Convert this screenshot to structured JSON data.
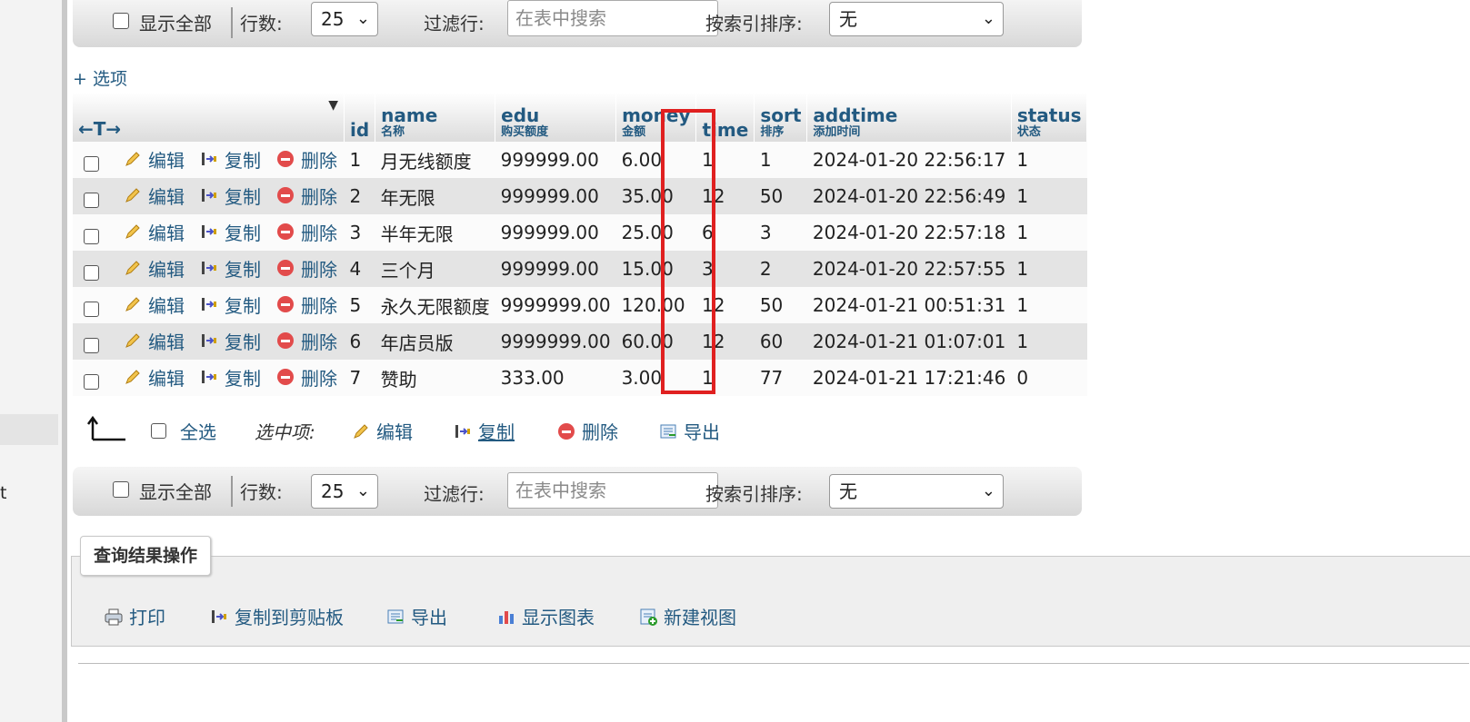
{
  "sidebar": {
    "fragment_text": "t"
  },
  "nav_top": {
    "show_all_label": "显示全部",
    "rows_label": "行数:",
    "rows_value": "25",
    "filter_label": "过滤行:",
    "filter_placeholder": "在表中搜索",
    "sort_by_index_label": "按索引排序:",
    "sort_by_index_value": "无"
  },
  "nav_bottom": {
    "show_all_label": "显示全部",
    "rows_label": "行数:",
    "rows_value": "25",
    "filter_label": "过滤行:",
    "filter_placeholder": "在表中搜索",
    "sort_by_index_label": "按索引排序:",
    "sort_by_index_value": "无"
  },
  "options_link": "+ 选项",
  "table": {
    "arrows_label": "←T→",
    "columns": [
      {
        "name": "id",
        "comment": ""
      },
      {
        "name": "name",
        "comment": "名称"
      },
      {
        "name": "edu",
        "comment": "购买额度"
      },
      {
        "name": "money",
        "comment": "金额"
      },
      {
        "name": "time",
        "comment": ""
      },
      {
        "name": "sort",
        "comment": "排序"
      },
      {
        "name": "addtime",
        "comment": "添加时间"
      },
      {
        "name": "status",
        "comment": "状态"
      }
    ],
    "actions": {
      "edit": "编辑",
      "copy": "复制",
      "delete": "删除"
    },
    "rows": [
      {
        "id": "1",
        "name": "月无线额度",
        "edu": "999999.00",
        "money": "6.00",
        "time": "1",
        "sort": "1",
        "addtime": "2024-01-20 22:56:17",
        "status": "1"
      },
      {
        "id": "2",
        "name": "年无限",
        "edu": "999999.00",
        "money": "35.00",
        "time": "12",
        "sort": "50",
        "addtime": "2024-01-20 22:56:49",
        "status": "1"
      },
      {
        "id": "3",
        "name": "半年无限",
        "edu": "999999.00",
        "money": "25.00",
        "time": "6",
        "sort": "3",
        "addtime": "2024-01-20 22:57:18",
        "status": "1"
      },
      {
        "id": "4",
        "name": "三个月",
        "edu": "999999.00",
        "money": "15.00",
        "time": "3",
        "sort": "2",
        "addtime": "2024-01-20 22:57:55",
        "status": "1"
      },
      {
        "id": "5",
        "name": "永久无限额度",
        "edu": "9999999.00",
        "money": "120.00",
        "time": "12",
        "sort": "50",
        "addtime": "2024-01-21 00:51:31",
        "status": "1"
      },
      {
        "id": "6",
        "name": "年店员版",
        "edu": "9999999.00",
        "money": "60.00",
        "time": "12",
        "sort": "60",
        "addtime": "2024-01-21 01:07:01",
        "status": "1"
      },
      {
        "id": "7",
        "name": "赞助",
        "edu": "333.00",
        "money": "3.00",
        "time": "1",
        "sort": "77",
        "addtime": "2024-01-21 17:21:46",
        "status": "0"
      }
    ]
  },
  "bulk": {
    "select_all": "全选",
    "with_selected": "选中项:",
    "edit": "编辑",
    "copy": "复制",
    "delete": "删除",
    "export": "导出"
  },
  "query_ops": {
    "legend": "查询结果操作",
    "print": "打印",
    "copy_clipboard": "复制到剪贴板",
    "export": "导出",
    "show_chart": "显示图表",
    "create_view": "新建视图"
  },
  "colors": {
    "link": "#235a81",
    "highlight": "#e02020"
  }
}
